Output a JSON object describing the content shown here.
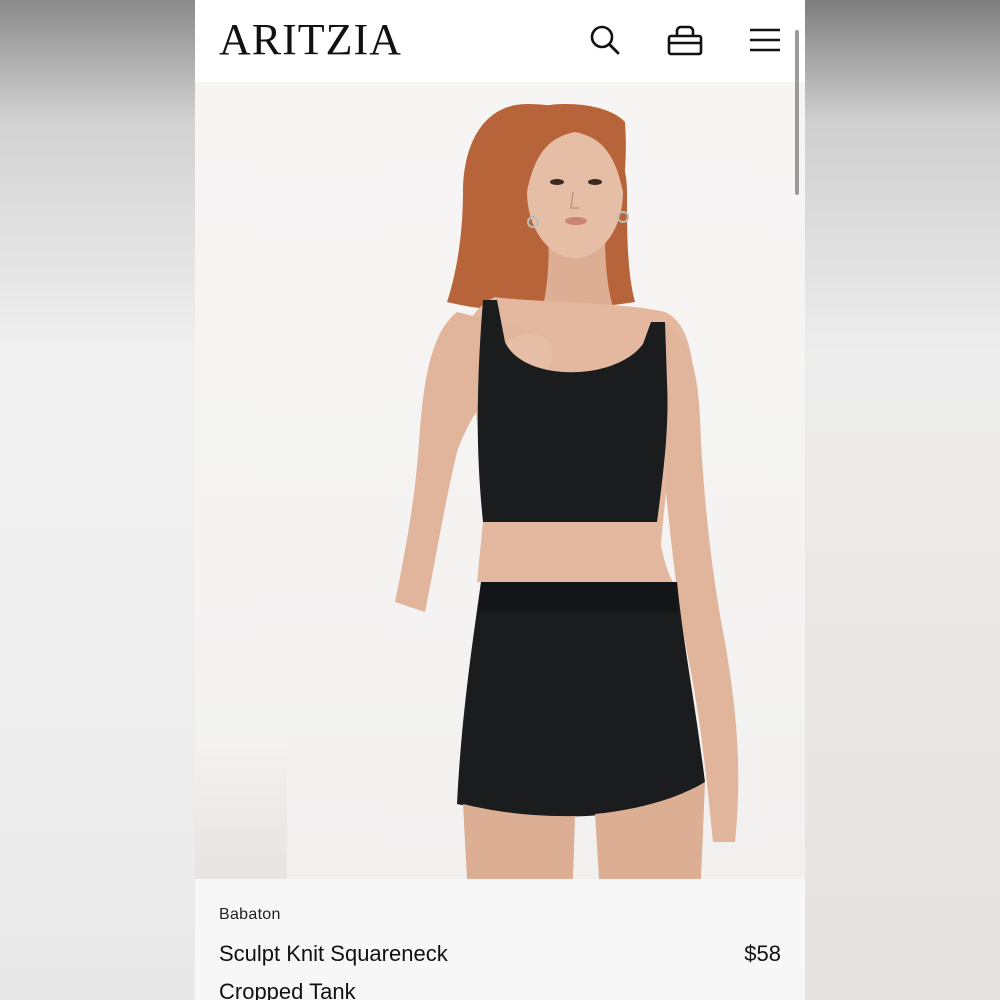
{
  "header": {
    "logo": "ARITZIA",
    "icons": [
      "search-icon",
      "shopping-bag-icon",
      "menu-icon"
    ]
  },
  "product": {
    "brand": "Babaton",
    "name_line1": "Sculpt Knit Squareneck",
    "name_line2": "Cropped Tank",
    "price": "$58"
  },
  "colors": {
    "text": "#111111",
    "top": "#1a1c1e",
    "skin": "#e3b89f",
    "hair": "#b8643a"
  }
}
